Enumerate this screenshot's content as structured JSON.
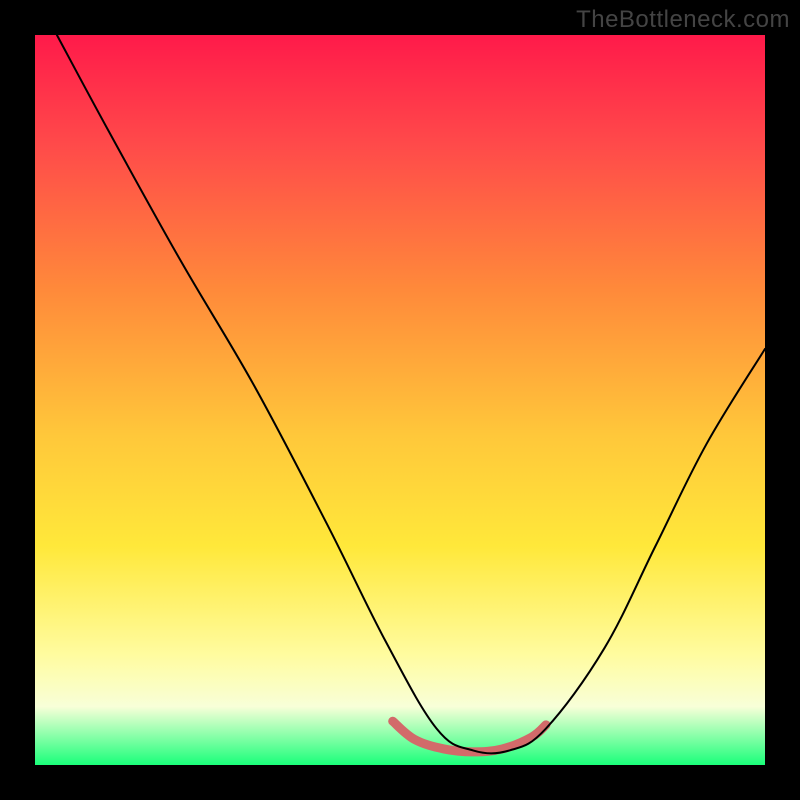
{
  "watermark": "TheBottleneck.com",
  "chart_data": {
    "type": "line",
    "title": "",
    "xlabel": "",
    "ylabel": "",
    "xlim": [
      0,
      1
    ],
    "ylim": [
      0,
      1
    ],
    "background_gradient": {
      "direction": "vertical",
      "stops": [
        {
          "pos": 0.0,
          "color": "#ff1a4a"
        },
        {
          "pos": 0.15,
          "color": "#ff4a4a"
        },
        {
          "pos": 0.35,
          "color": "#ff8a3a"
        },
        {
          "pos": 0.55,
          "color": "#ffc83a"
        },
        {
          "pos": 0.7,
          "color": "#ffe83a"
        },
        {
          "pos": 0.85,
          "color": "#fffca0"
        },
        {
          "pos": 0.92,
          "color": "#f8ffd8"
        },
        {
          "pos": 1.0,
          "color": "#1aff7a"
        }
      ]
    },
    "series": [
      {
        "name": "main-curve",
        "color": "#000000",
        "stroke_width": 2,
        "x": [
          0.03,
          0.1,
          0.2,
          0.3,
          0.4,
          0.48,
          0.55,
          0.6,
          0.65,
          0.7,
          0.78,
          0.85,
          0.92,
          1.0
        ],
        "y": [
          1.0,
          0.87,
          0.69,
          0.52,
          0.33,
          0.17,
          0.05,
          0.02,
          0.02,
          0.05,
          0.16,
          0.3,
          0.44,
          0.57
        ]
      },
      {
        "name": "trough-highlight",
        "color": "#d26a6a",
        "stroke_width": 9,
        "x": [
          0.49,
          0.52,
          0.56,
          0.6,
          0.64,
          0.68,
          0.7
        ],
        "y": [
          0.06,
          0.035,
          0.022,
          0.018,
          0.022,
          0.038,
          0.055
        ]
      }
    ]
  }
}
